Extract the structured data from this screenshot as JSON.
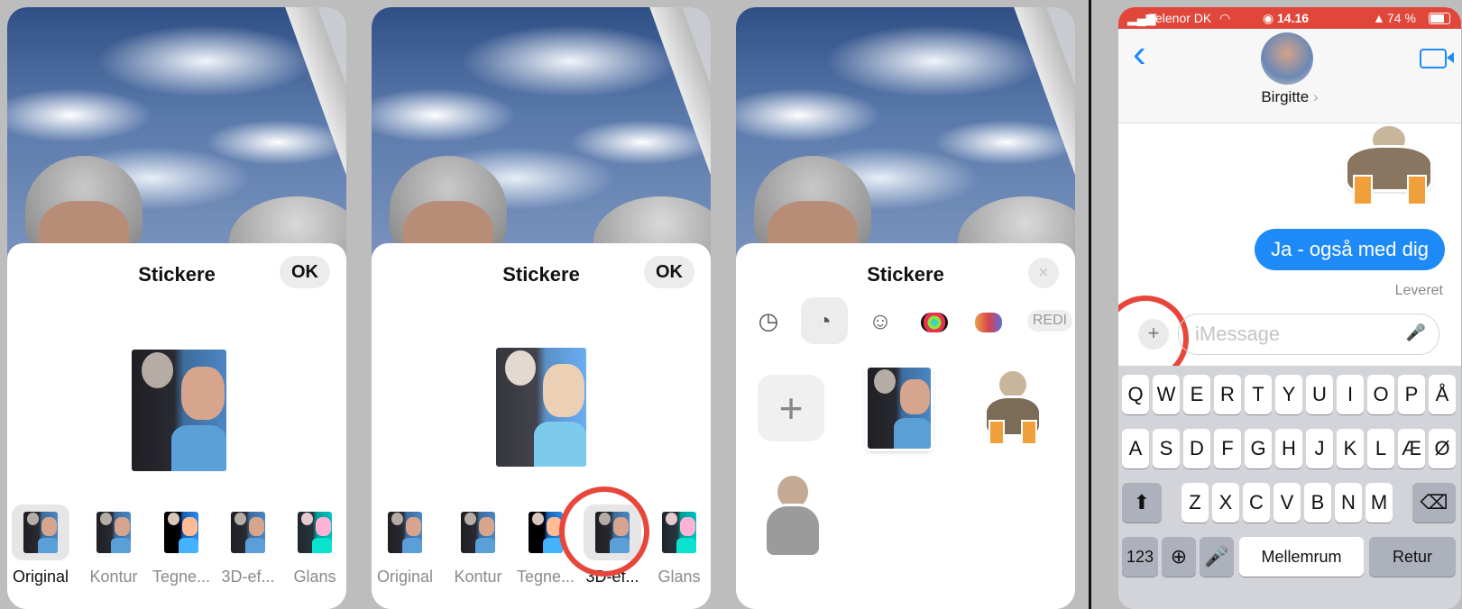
{
  "panels": [
    {
      "sheet_title": "Stickere",
      "action": "OK",
      "effects": [
        "Original",
        "Kontur",
        "Tegne...",
        "3D-ef...",
        "Glans"
      ],
      "selected_effect": 0
    },
    {
      "sheet_title": "Stickere",
      "action": "OK",
      "effects": [
        "Original",
        "Kontur",
        "Tegne...",
        "3D-ef...",
        "Glans"
      ],
      "selected_effect": 3
    },
    {
      "sheet_title": "Stickere",
      "close_icon": "×",
      "tabs": [
        "recents-icon",
        "stickers-icon",
        "emoji-icon",
        "activity-rings-icon",
        "memoji-icon"
      ],
      "tab_extra": "REDI",
      "add_label": "+"
    }
  ],
  "messages": {
    "status": {
      "carrier": "Telenor DK",
      "time": "14.16",
      "battery": "74 %"
    },
    "back": "‹",
    "contact": "Birgitte",
    "contact_chevron": "›",
    "bubble": "Ja - også med dig",
    "delivered": "Leveret",
    "plus": "+",
    "input_placeholder": "iMessage",
    "keyboard": {
      "row1": [
        "Q",
        "W",
        "E",
        "R",
        "T",
        "Y",
        "U",
        "I",
        "O",
        "P",
        "Å"
      ],
      "row2": [
        "A",
        "S",
        "D",
        "F",
        "G",
        "H",
        "J",
        "K",
        "L",
        "Æ",
        "Ø"
      ],
      "row3": [
        "Z",
        "X",
        "C",
        "V",
        "B",
        "N",
        "M"
      ],
      "numbers": "123",
      "space": "Mellemrum",
      "return": "Retur"
    }
  },
  "colors": {
    "accent": "#1e8af7",
    "highlight_circle": "#e8463b",
    "status_bar": "#e0463a"
  }
}
